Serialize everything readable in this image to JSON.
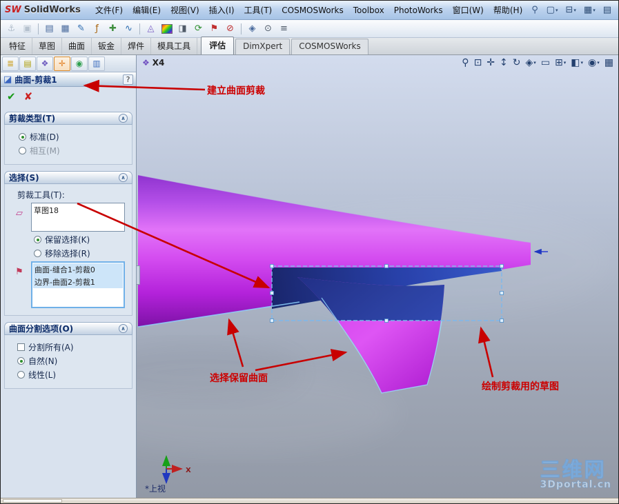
{
  "ui": {
    "caret": "▾"
  },
  "titlebar": {
    "logo_mark": "SW",
    "logo_text": "SolidWorks",
    "menus": [
      "文件(F)",
      "编辑(E)",
      "视图(V)",
      "插入(I)",
      "工具(T)",
      "COSMOSWorks",
      "Toolbox",
      "PhotoWorks",
      "窗口(W)",
      "帮助(H)"
    ],
    "search_icon": "⚲",
    "doc_icons": [
      "▢",
      "⊟",
      "▦",
      "▤"
    ]
  },
  "toolbar": {
    "icons": [
      "⚓",
      "▣",
      "▤",
      "▦",
      "✎",
      "ƒ",
      "✚",
      "∿",
      "◬",
      "◨",
      "⟳",
      "⚑",
      "⊘",
      "◈",
      "⊙",
      "≡"
    ]
  },
  "command_tabs": {
    "items": [
      "特征",
      "草图",
      "曲面",
      "钣金",
      "焊件",
      "模具工具",
      "评估",
      "DimXpert",
      "COSMOSWorks"
    ]
  },
  "panel": {
    "tab_icons": [
      "≣",
      "▤",
      "❖",
      "✛",
      "◉",
      "▥"
    ],
    "title_icon": "◪",
    "title": "曲面-剪裁1",
    "help": "?",
    "ok_icon": "✔",
    "cancel_icon": "✘",
    "collapse_icon": "∧",
    "trim_type": {
      "header": "剪裁类型(T)",
      "standard": "标准(D)",
      "mutual": "相互(M)"
    },
    "selection": {
      "header": "选择(S)",
      "tool_label": "剪裁工具(T):",
      "tool_value": "草图18",
      "keep": "保留选择(K)",
      "remove": "移除选择(R)",
      "pieces": [
        "曲面-缝合1-剪裁0",
        "边界-曲面2-剪裁1"
      ]
    },
    "split": {
      "header": "曲面分割选项(O)",
      "split_all": "分割所有(A)",
      "natural": "自然(N)",
      "linear": "线性(L)"
    }
  },
  "viewport": {
    "zoom_icon": "❖",
    "zoom_indicator": "X4",
    "view_icons": [
      "⚲",
      "⊡",
      "✛",
      "↕",
      "↻",
      "◈",
      "▭",
      "⊞",
      "◧",
      "◉",
      "▦"
    ],
    "view_name": "*上视",
    "triad_x": "X",
    "watermark_title": "三维网",
    "watermark_sub": "3Dportal.cn"
  },
  "annotations": {
    "create_trim": "建立曲面剪裁",
    "keep_surface": "选择保留曲面",
    "sketch_for_trim": "绘制剪裁用的草图"
  }
}
